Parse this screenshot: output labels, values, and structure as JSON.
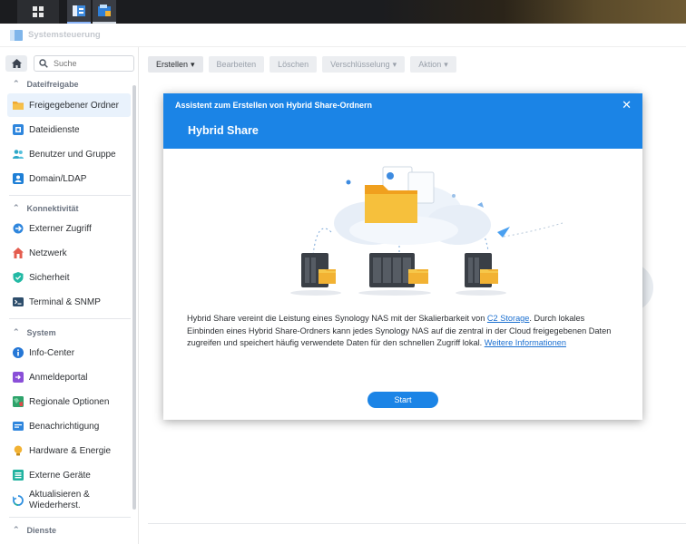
{
  "window": {
    "title": "Systemsteuerung"
  },
  "search": {
    "placeholder": "Suche"
  },
  "sidebar": {
    "sections": [
      {
        "label": "Dateifreigabe",
        "items": [
          "Freigegebener Ordner",
          "Dateidienste",
          "Benutzer und Gruppe",
          "Domain/LDAP"
        ]
      },
      {
        "label": "Konnektivität",
        "items": [
          "Externer Zugriff",
          "Netzwerk",
          "Sicherheit",
          "Terminal & SNMP"
        ]
      },
      {
        "label": "System",
        "items": [
          "Info-Center",
          "Anmeldeportal",
          "Regionale Optionen",
          "Benachrichtigung",
          "Hardware & Energie",
          "Externe Geräte",
          "Aktualisieren &",
          "Wiederherst."
        ]
      },
      {
        "label": "Dienste"
      }
    ]
  },
  "toolbar": {
    "create": "Erstellen",
    "edit": "Bearbeiten",
    "delete": "Löschen",
    "encryption": "Verschlüsselung",
    "action": "Aktion"
  },
  "dialog": {
    "window_title": "Assistent zum Erstellen von Hybrid Share-Ordnern",
    "heading": "Hybrid Share",
    "desc_part1": "Hybrid Share vereint die Leistung eines Synology NAS mit der Skalierbarkeit von ",
    "link_c2": "C2 Storage",
    "desc_part2": ". Durch lokales Einbinden eines Hybrid Share-Ordners kann jedes Synology NAS auf die zentral in der Cloud freigegebenen Daten zugreifen und speichert häufig verwendete Daten für den schnellen Zugriff lokal. ",
    "link_more": "Weitere Informationen",
    "start": "Start"
  },
  "colors": {
    "accent": "#1b84e6",
    "link": "#1b6fd0",
    "active_bg": "#e9f2fc"
  },
  "icons": {
    "taskbar": [
      "main-menu-icon",
      "control-panel-icon",
      "file-station-icon"
    ],
    "sidebar": [
      "folder-icon",
      "file-services-icon",
      "users-icon",
      "domain-icon",
      "external-access-icon",
      "network-icon",
      "security-shield-icon",
      "terminal-icon",
      "info-icon",
      "login-portal-icon",
      "region-icon",
      "notification-icon",
      "hardware-icon",
      "external-devices-icon",
      "update-icon"
    ]
  }
}
